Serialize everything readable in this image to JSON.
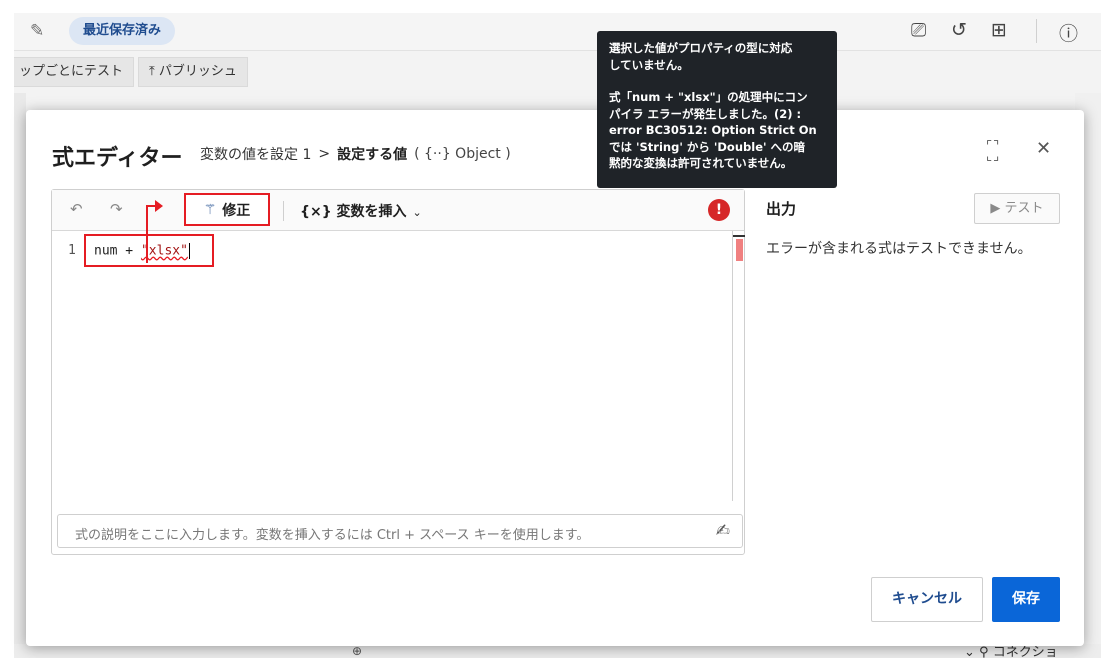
{
  "background": {
    "saved_badge": "最近保存済み",
    "step_test": "ップごとにテスト",
    "publish": "パブリッシュ",
    "connection": "コネクショ"
  },
  "dialog": {
    "title": "式エディター",
    "breadcrumb": {
      "parent": "変数の値を設定 1",
      "separator": ">",
      "current": "設定する値",
      "type": "( {··} Object )"
    }
  },
  "toolbar": {
    "fix_label": "修正",
    "insert_variable_label": "{×} 変数を挿入",
    "error_symbol": "!"
  },
  "editor": {
    "line_number": "1",
    "code_prefix": "num + ",
    "code_string": "\"xlsx\"",
    "description_placeholder": "式の説明をここに入力します。変数を挿入するには Ctrl + スペース キーを使用します。"
  },
  "output": {
    "title": "出力",
    "test_button": "▶ テスト",
    "message": "エラーが含まれる式はテストできません。"
  },
  "footer": {
    "cancel_label": "キャンセル",
    "save_label": "保存"
  },
  "tooltip": {
    "line1": "選択した値がプロパティの型に対応\nしていません。",
    "line2": "式「num + \"xlsx\"」の処理中にコン\nパイラ エラーが発生しました。(2) :\nerror BC30512: Option Strict On\nでは 'String' から 'Double' への暗\n黙的な変換は許可されていません。"
  },
  "colors": {
    "accent": "#0a66d8",
    "error": "#d62728",
    "annotation": "#e51c23",
    "tooltip_bg": "#1f2328"
  }
}
